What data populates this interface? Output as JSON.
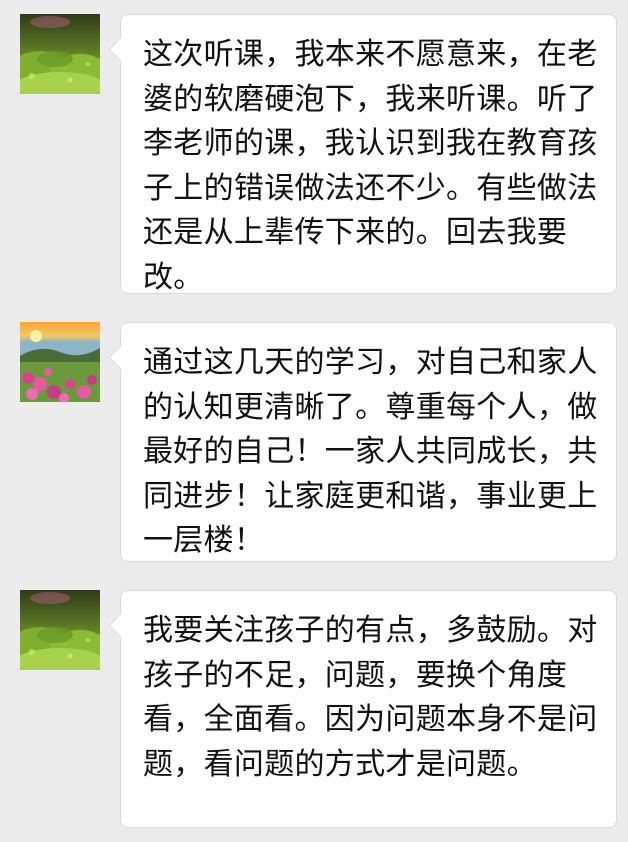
{
  "messages": [
    {
      "avatar": "moss-green-avatar",
      "text": "这次听课，我本来不愿意来，在老婆的软磨硬泡下，我来听课。听了李老师的课，我认识到我在教育孩子上的错误做法还不少。有些做法还是从上辈传下来的。回去我要改。"
    },
    {
      "avatar": "flower-landscape-avatar",
      "text": "通过这几天的学习，对自己和家人的认知更清晰了。尊重每个人，做最好的自己！一家人共同成长，共同进步！让家庭更和谐，事业更上一层楼！"
    },
    {
      "avatar": "moss-green-avatar",
      "text": "我要关注孩子的有点，多鼓励。对孩子的不足，问题，要换个角度看，全面看。因为问题本身不是问题，看问题的方式才是问题。"
    }
  ],
  "colors": {
    "background": "#ececec",
    "bubble": "#ffffff",
    "bubble_border": "#d9d9d9",
    "text": "#111111"
  }
}
